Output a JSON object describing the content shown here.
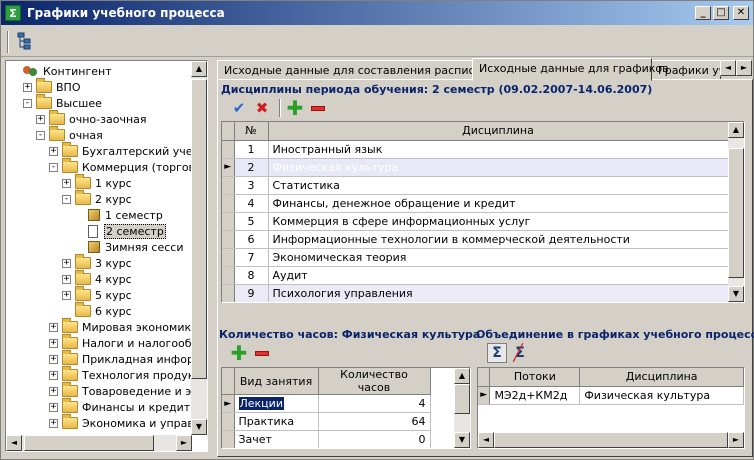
{
  "window": {
    "title": "Графики учебного процесса",
    "buttons": [
      "_",
      "□",
      "✕"
    ]
  },
  "tree": {
    "items": [
      {
        "label": "Контингент",
        "icon": "people-icon",
        "level": 0,
        "exp": ""
      },
      {
        "label": "ВПО",
        "icon": "folder-icon",
        "level": 1,
        "exp": "+"
      },
      {
        "label": "Высшее",
        "icon": "folder-icon",
        "level": 1,
        "exp": "−"
      },
      {
        "label": "очно-заочная",
        "icon": "folder-icon",
        "level": 2,
        "exp": "+"
      },
      {
        "label": "очная",
        "icon": "folder-icon",
        "level": 2,
        "exp": "−"
      },
      {
        "label": "Бухгалтерский учет,",
        "icon": "folder-icon",
        "level": 3,
        "exp": "+"
      },
      {
        "label": "Коммерция (торгово",
        "icon": "folder-icon",
        "level": 3,
        "exp": "−"
      },
      {
        "label": "1 курс",
        "icon": "folder-icon",
        "level": 4,
        "exp": "+"
      },
      {
        "label": "2 курс",
        "icon": "folder-icon",
        "level": 4,
        "exp": "−"
      },
      {
        "label": "1 семестр",
        "icon": "cube-icon",
        "level": 5,
        "exp": ""
      },
      {
        "label": "2 семестр",
        "icon": "document-icon",
        "level": 5,
        "exp": "",
        "selected": true
      },
      {
        "label": "Зимняя сесси",
        "icon": "cube-icon",
        "level": 5,
        "exp": ""
      },
      {
        "label": "3 курс",
        "icon": "folder-icon",
        "level": 4,
        "exp": "+"
      },
      {
        "label": "4 курс",
        "icon": "folder-icon",
        "level": 4,
        "exp": "+"
      },
      {
        "label": "5 курс",
        "icon": "folder-icon",
        "level": 4,
        "exp": "+"
      },
      {
        "label": "6 курс",
        "icon": "folder-icon",
        "level": 4,
        "exp": ""
      },
      {
        "label": "Мировая экономика",
        "icon": "folder-icon",
        "level": 3,
        "exp": "+"
      },
      {
        "label": "Налоги и налогообло",
        "icon": "folder-icon",
        "level": 3,
        "exp": "+"
      },
      {
        "label": "Прикладная информ",
        "icon": "folder-icon",
        "level": 3,
        "exp": "+"
      },
      {
        "label": "Технология продукт",
        "icon": "folder-icon",
        "level": 3,
        "exp": "+"
      },
      {
        "label": "Товароведение и экс",
        "icon": "folder-icon",
        "level": 3,
        "exp": "+"
      },
      {
        "label": "Финансы и кредит",
        "icon": "folder-icon",
        "level": 3,
        "exp": "+"
      },
      {
        "label": "Экономика и управл",
        "icon": "folder-icon",
        "level": 3,
        "exp": "+"
      }
    ]
  },
  "tabs": [
    {
      "label": "Исходные данные для составления расписания"
    },
    {
      "label": "Исходные данные для графиков",
      "active": true
    },
    {
      "label": "Графики уч"
    }
  ],
  "disciplines": {
    "title": "Дисциплины периода обучения: 2 семестр (09.02.2007-14.06.2007)",
    "columns": {
      "num": "№",
      "name": "Дисциплина"
    },
    "rows": [
      {
        "num": "1",
        "name": "Иностранный язык"
      },
      {
        "num": "2",
        "name": "Физическая культура",
        "current": true
      },
      {
        "num": "3",
        "name": "Статистика"
      },
      {
        "num": "4",
        "name": "Финансы, денежное обращение и кредит"
      },
      {
        "num": "5",
        "name": "Коммерция в сфере информационных услуг"
      },
      {
        "num": "6",
        "name": "Информационные технологии в коммерческой деятельности"
      },
      {
        "num": "7",
        "name": "Экономическая теория"
      },
      {
        "num": "8",
        "name": "Аудит"
      },
      {
        "num": "9",
        "name": "Психология управления"
      }
    ]
  },
  "hours": {
    "title": "Количество часов: Физическая культура",
    "columns": {
      "type": "Вид занятия",
      "hours": "Количество часов"
    },
    "rows": [
      {
        "type": "Лекции",
        "hours": "4",
        "current": true
      },
      {
        "type": "Практика",
        "hours": "64"
      },
      {
        "type": "Зачет",
        "hours": "0"
      }
    ]
  },
  "union": {
    "title": "Объединение в графиках учебного процесса:",
    "columns": {
      "streams": "Потоки",
      "discipline": "Дисциплина"
    },
    "rows": [
      {
        "streams": "МЭ2д+КМ2д",
        "discipline": "Физическая культура"
      }
    ]
  },
  "colors": {
    "title_start": "#0a246a",
    "title_end": "#a6caf0",
    "section_title": "#0a246a",
    "alt_row": "#ebeaf6",
    "selection": "#0a246a"
  }
}
